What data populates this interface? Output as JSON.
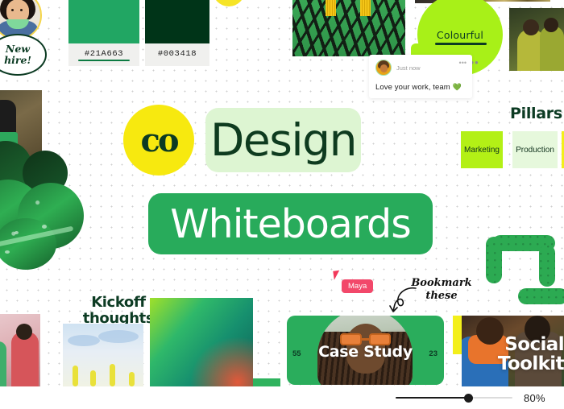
{
  "app": {
    "title": "co Design Whiteboards",
    "background": "#ffffff",
    "accent_green": "#21a663",
    "accent_dark_green": "#003418",
    "accent_lime": "#a8f018",
    "accent_yellow": "#f7e90f"
  },
  "board": {
    "logo_text": "co",
    "heading_design": "Design",
    "heading_whiteboards": "Whiteboards",
    "kickoff_line1": "Kickoff",
    "kickoff_line2": "thoughts",
    "new_hire_line1": "New",
    "new_hire_line2": "hire!",
    "bookmark_line1": "Bookmark",
    "bookmark_line2": "these"
  },
  "swatches": [
    {
      "hex": "#21A663",
      "color": "#21a663",
      "underlined": true
    },
    {
      "hex": "#003418",
      "color": "#003418",
      "underlined": false
    }
  ],
  "bubble": {
    "text": "Colourful",
    "color": "#a8f018",
    "menu": "•••"
  },
  "comment": {
    "timestamp": "Just now",
    "message": "Love your work, team",
    "emoji": "💚",
    "menu": "•••"
  },
  "pillars": {
    "title": "Pillars",
    "notes": [
      {
        "label": "Marketing",
        "color": "#b3f016"
      },
      {
        "label": "Production",
        "color": "#e6f8dc"
      }
    ]
  },
  "cursor": {
    "user": "Maya",
    "color": "#f2486a"
  },
  "cards": {
    "case_study": {
      "label": "Case Study",
      "left_number": "55",
      "right_number": "23"
    },
    "social_toolkit": {
      "line1": "Social",
      "line2": "Toolkit"
    }
  },
  "toolbar": {
    "zoom_value": "80%",
    "zoom_percent": 62
  }
}
